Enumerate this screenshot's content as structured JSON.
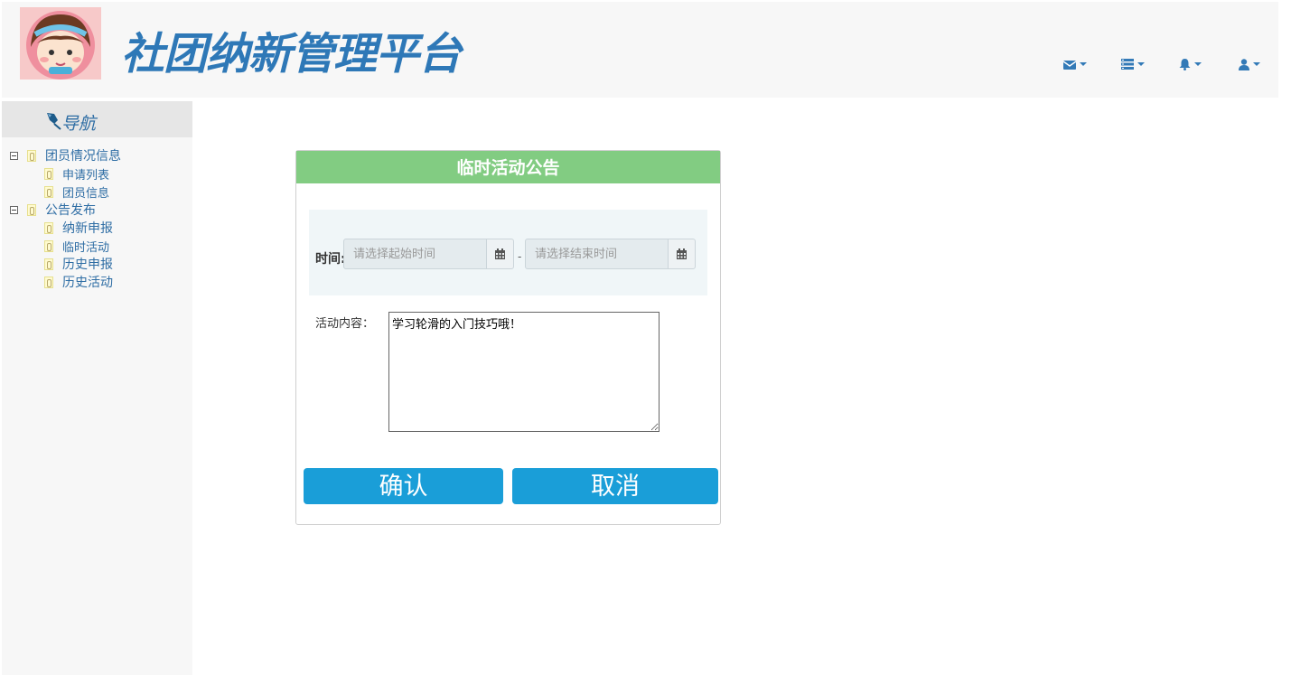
{
  "header": {
    "title": "社团纳新管理平台",
    "nav_icons": [
      "envelope-icon",
      "list-icon",
      "bell-icon",
      "user-icon"
    ]
  },
  "sidebar": {
    "title": "导航",
    "groups": [
      {
        "label": "团员情况信息",
        "items": [
          "申请列表",
          "团员信息"
        ]
      },
      {
        "label": "公告发布",
        "items": [
          "纳新申报",
          "临时活动",
          "历史申报",
          "历史活动"
        ]
      }
    ]
  },
  "panel": {
    "title": "临时活动公告",
    "time_label": "时间:",
    "start_placeholder": "请选择起始时间",
    "end_placeholder": "请选择结束时间",
    "separator": "-",
    "content_label": "活动内容：",
    "content_value": "学习轮滑的入门技巧哦！",
    "confirm_label": "确认",
    "cancel_label": "取消"
  },
  "colors": {
    "accent": "#2e78b7",
    "panel_header": "#82cc82",
    "button": "#1a9ed8"
  }
}
